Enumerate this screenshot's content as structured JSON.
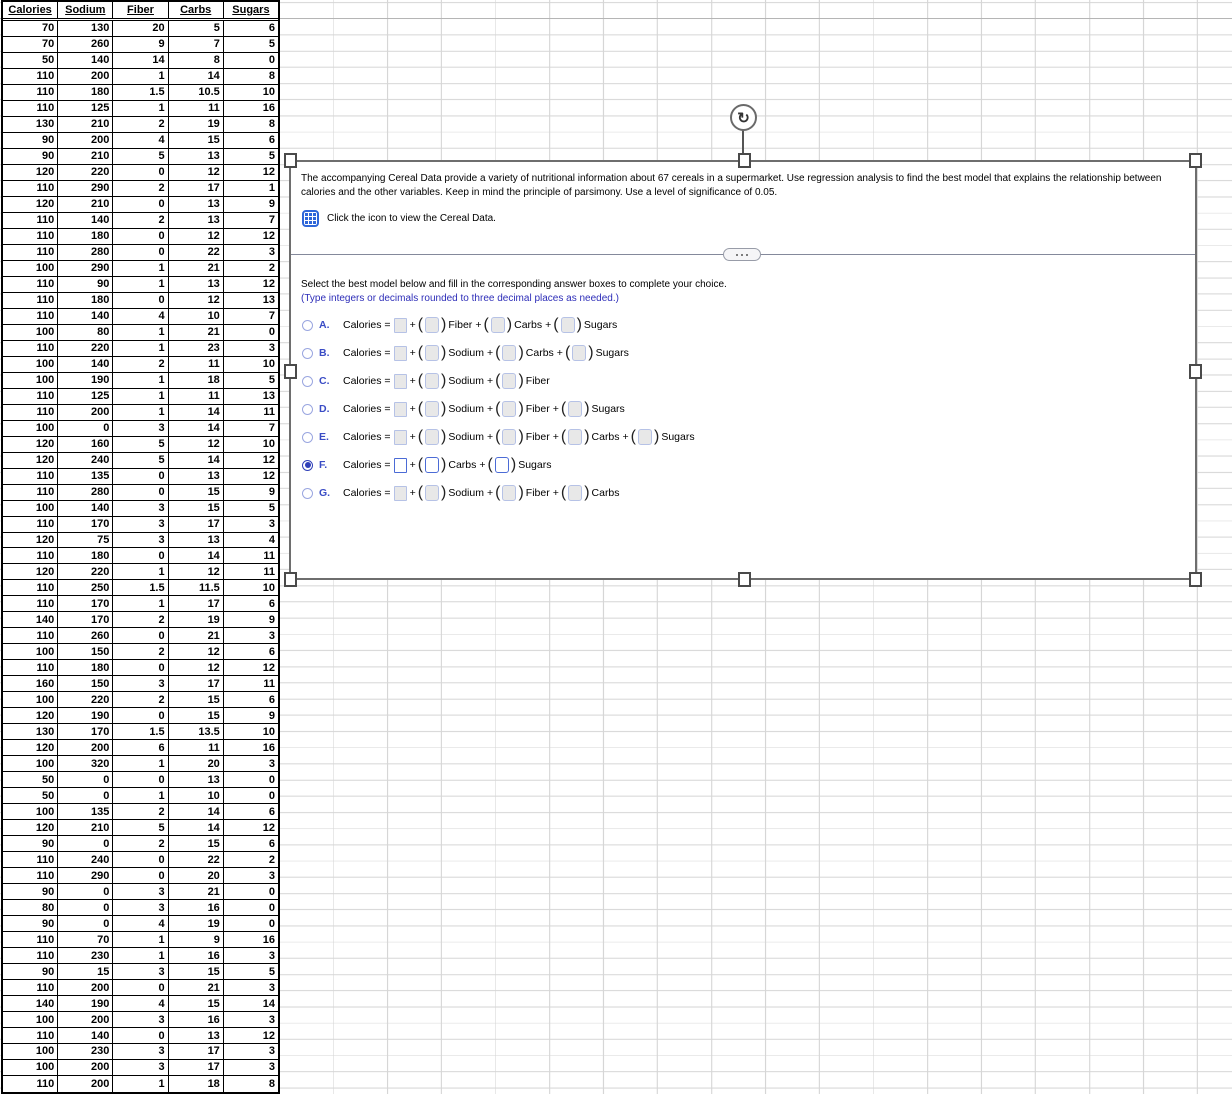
{
  "table": {
    "headers": [
      "Calories",
      "Sodium",
      "Fiber",
      "Carbs",
      "Sugars"
    ],
    "rows": [
      [
        70,
        130,
        20,
        5,
        6
      ],
      [
        70,
        260,
        9,
        7,
        5
      ],
      [
        50,
        140,
        14,
        8,
        0
      ],
      [
        110,
        200,
        1,
        14,
        8
      ],
      [
        110,
        180,
        1.5,
        10.5,
        10
      ],
      [
        110,
        125,
        1,
        11,
        16
      ],
      [
        130,
        210,
        2,
        19,
        8
      ],
      [
        90,
        200,
        4,
        15,
        6
      ],
      [
        90,
        210,
        5,
        13,
        5
      ],
      [
        120,
        220,
        0,
        12,
        12
      ],
      [
        110,
        290,
        2,
        17,
        1
      ],
      [
        120,
        210,
        0,
        13,
        9
      ],
      [
        110,
        140,
        2,
        13,
        7
      ],
      [
        110,
        180,
        0,
        12,
        12
      ],
      [
        110,
        280,
        0,
        22,
        3
      ],
      [
        100,
        290,
        1,
        21,
        2
      ],
      [
        110,
        90,
        1,
        13,
        12
      ],
      [
        110,
        180,
        0,
        12,
        13
      ],
      [
        110,
        140,
        4,
        10,
        7
      ],
      [
        100,
        80,
        1,
        21,
        0
      ],
      [
        110,
        220,
        1,
        23,
        3
      ],
      [
        100,
        140,
        2,
        11,
        10
      ],
      [
        100,
        190,
        1,
        18,
        5
      ],
      [
        110,
        125,
        1,
        11,
        13
      ],
      [
        110,
        200,
        1,
        14,
        11
      ],
      [
        100,
        0,
        3,
        14,
        7
      ],
      [
        120,
        160,
        5,
        12,
        10
      ],
      [
        120,
        240,
        5,
        14,
        12
      ],
      [
        110,
        135,
        0,
        13,
        12
      ],
      [
        110,
        280,
        0,
        15,
        9
      ],
      [
        100,
        140,
        3,
        15,
        5
      ],
      [
        110,
        170,
        3,
        17,
        3
      ],
      [
        120,
        75,
        3,
        13,
        4
      ],
      [
        110,
        180,
        0,
        14,
        11
      ],
      [
        120,
        220,
        1,
        12,
        11
      ],
      [
        110,
        250,
        1.5,
        11.5,
        10
      ],
      [
        110,
        170,
        1,
        17,
        6
      ],
      [
        140,
        170,
        2,
        19,
        9
      ],
      [
        110,
        260,
        0,
        21,
        3
      ],
      [
        100,
        150,
        2,
        12,
        6
      ],
      [
        110,
        180,
        0,
        12,
        12
      ],
      [
        160,
        150,
        3,
        17,
        11
      ],
      [
        100,
        220,
        2,
        15,
        6
      ],
      [
        120,
        190,
        0,
        15,
        9
      ],
      [
        130,
        170,
        1.5,
        13.5,
        10
      ],
      [
        120,
        200,
        6,
        11,
        16
      ],
      [
        100,
        320,
        1,
        20,
        3
      ],
      [
        50,
        0,
        0,
        13,
        0
      ],
      [
        50,
        0,
        1,
        10,
        0
      ],
      [
        100,
        135,
        2,
        14,
        6
      ],
      [
        120,
        210,
        5,
        14,
        12
      ],
      [
        90,
        0,
        2,
        15,
        6
      ],
      [
        110,
        240,
        0,
        22,
        2
      ],
      [
        110,
        290,
        0,
        20,
        3
      ],
      [
        90,
        0,
        3,
        21,
        0
      ],
      [
        80,
        0,
        3,
        16,
        0
      ],
      [
        90,
        0,
        4,
        19,
        0
      ],
      [
        110,
        70,
        1,
        9,
        16
      ],
      [
        110,
        230,
        1,
        16,
        3
      ],
      [
        90,
        15,
        3,
        15,
        5
      ],
      [
        110,
        200,
        0,
        21,
        3
      ],
      [
        140,
        190,
        4,
        15,
        14
      ],
      [
        100,
        200,
        3,
        16,
        3
      ],
      [
        110,
        140,
        0,
        13,
        12
      ],
      [
        100,
        230,
        3,
        17,
        3
      ],
      [
        100,
        200,
        3,
        17,
        3
      ],
      [
        110,
        200,
        1,
        18,
        8
      ]
    ]
  },
  "dialog": {
    "question_lines": [
      "The accompanying Cereal Data provide a variety of nutritional information about 67 cereals in a supermarket. Use regression analysis to find the best model that explains the relationship between",
      "calories and the other variables. Keep in mind the principle of parsimony. Use a level of significance of 0.05."
    ],
    "icon_caption": "Click the icon to view the Cereal Data.",
    "select_instruction": "Select the best model below and fill in the corresponding answer boxes to complete your choice.",
    "format_note": "(Type integers or decimals rounded to three decimal places as needed.)",
    "rotate_glyph": "↻",
    "equation_lhs": "Calories =",
    "plus": "+",
    "paren_open": "(",
    "paren_close": ")",
    "options": [
      {
        "letter": "A.",
        "terms": [
          "Fiber",
          "Carbs",
          "Sugars"
        ],
        "selected": false
      },
      {
        "letter": "B.",
        "terms": [
          "Sodium",
          "Carbs",
          "Sugars"
        ],
        "selected": false
      },
      {
        "letter": "C.",
        "terms": [
          "Sodium",
          "Fiber"
        ],
        "selected": false
      },
      {
        "letter": "D.",
        "terms": [
          "Sodium",
          "Fiber",
          "Sugars"
        ],
        "selected": false
      },
      {
        "letter": "E.",
        "terms": [
          "Sodium",
          "Fiber",
          "Carbs",
          "Sugars"
        ],
        "selected": false
      },
      {
        "letter": "F.",
        "terms": [
          "Carbs",
          "Sugars"
        ],
        "selected": true
      },
      {
        "letter": "G.",
        "terms": [
          "Sodium",
          "Fiber",
          "Carbs"
        ],
        "selected": false
      }
    ],
    "answer_box_value": ""
  },
  "colors": {
    "accent_blue": "#2d2db8",
    "option_letter_blue": "#3a4cc5",
    "icon_blue": "#2e66d9",
    "active_box_border": "#4b6bd6",
    "dialog_border": "#6e6e6e",
    "grid_line": "#d6d6d6"
  }
}
